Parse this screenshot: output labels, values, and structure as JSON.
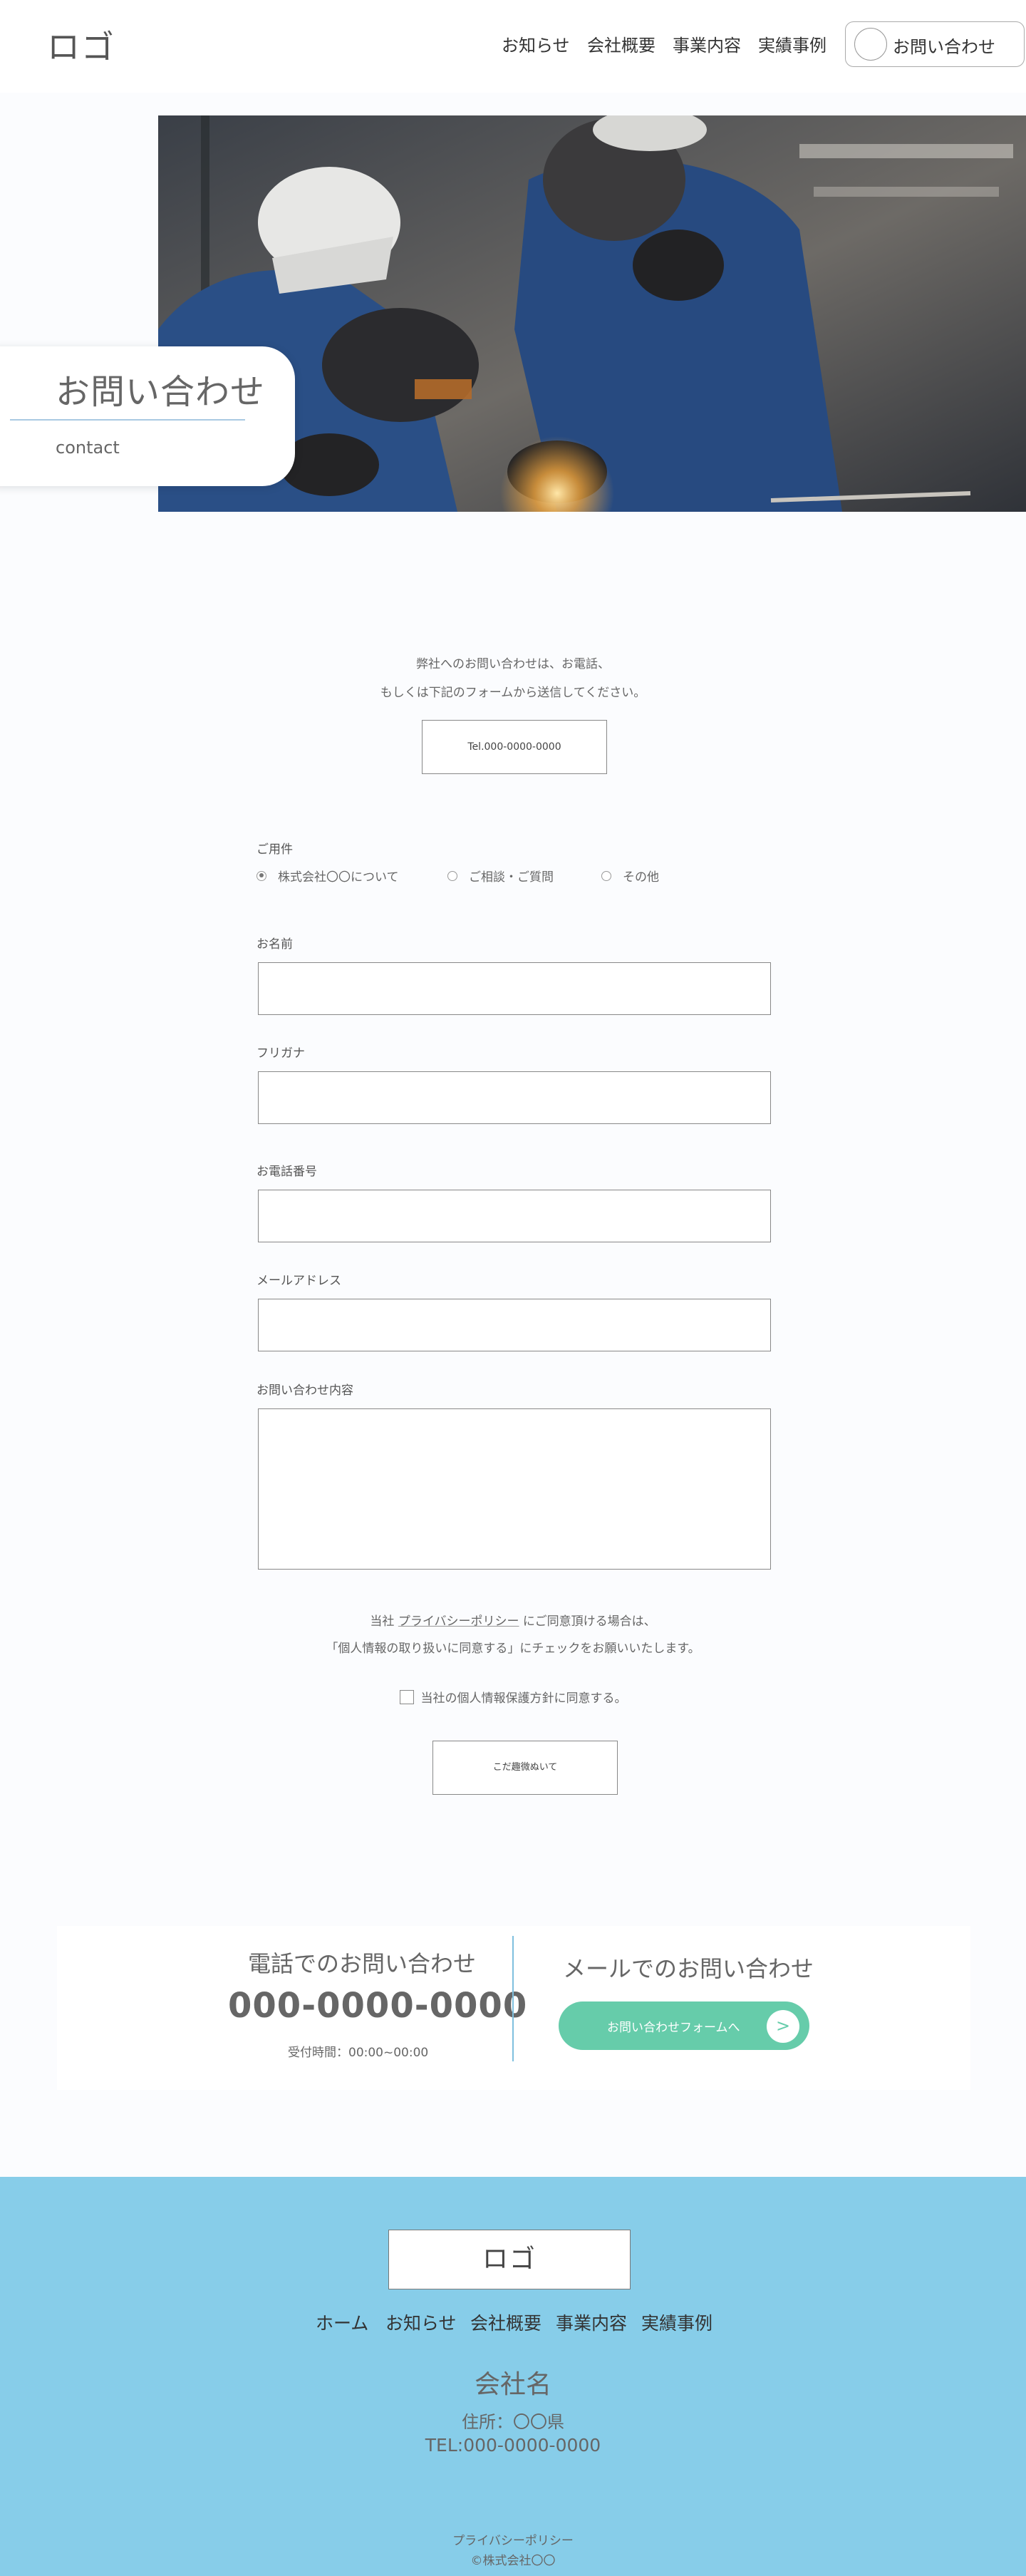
{
  "header": {
    "logo": "ロゴ",
    "nav": [
      "お知らせ",
      "会社概要",
      "事業内容",
      "実績事例"
    ],
    "cta_label": "お問い合わせ"
  },
  "hero": {
    "title": "お問い合わせ",
    "subtitle": "contact"
  },
  "intro": {
    "line1": "弊社へのお問い合わせは、お電話、",
    "line2": "もしくは下記のフォームから送信してください。",
    "tel_box": "Tel.000-0000-0000"
  },
  "form": {
    "purpose_label": "ご用件",
    "purpose_options": [
      "株式会社〇〇について",
      "ご相談・ご質問",
      "その他"
    ],
    "purpose_selected": "株式会社〇〇について",
    "name_label": "お名前",
    "name_value": "",
    "kana_label": "フリガナ",
    "kana_value": "",
    "phone_label": "お電話番号",
    "phone_value": "",
    "email_label": "メールアドレス",
    "email_value": "",
    "message_label": "お問い合わせ内容",
    "message_value": "",
    "privacy_prefix": "当社",
    "privacy_link": "プライバシーポリシー",
    "privacy_suffix": "にご同意頂ける場合は、",
    "privacy_line2": "「個人情報の取り扱いに同意する」にチェックをお願いいたします。",
    "agree_label": "当社の個人情報保護方針に同意する。",
    "agree_checked": false,
    "submit_label": "こだ趣微ぬいて"
  },
  "contact_panel": {
    "phone_heading": "電話でのお問い合わせ",
    "phone_number": "000-0000-0000",
    "hours": "受付時間：00:00~00:00",
    "mail_heading": "メールでのお問い合わせ",
    "mail_button": "お問い合わせフォームへ",
    "mail_button_icon": ">"
  },
  "footer": {
    "logo": "ロゴ",
    "nav": [
      "ホーム",
      "お知らせ",
      "会社概要",
      "事業内容",
      "実績事例"
    ],
    "company_name": "会社名",
    "address": "住所：〇〇県",
    "tel": "TEL:000-0000-0000",
    "privacy": "プライバシーポリシー",
    "copyright": "©株式会社〇〇"
  },
  "colors": {
    "accent_green": "#66ccaa",
    "footer_blue": "#87cde9",
    "divider_blue": "#7fc0de"
  }
}
